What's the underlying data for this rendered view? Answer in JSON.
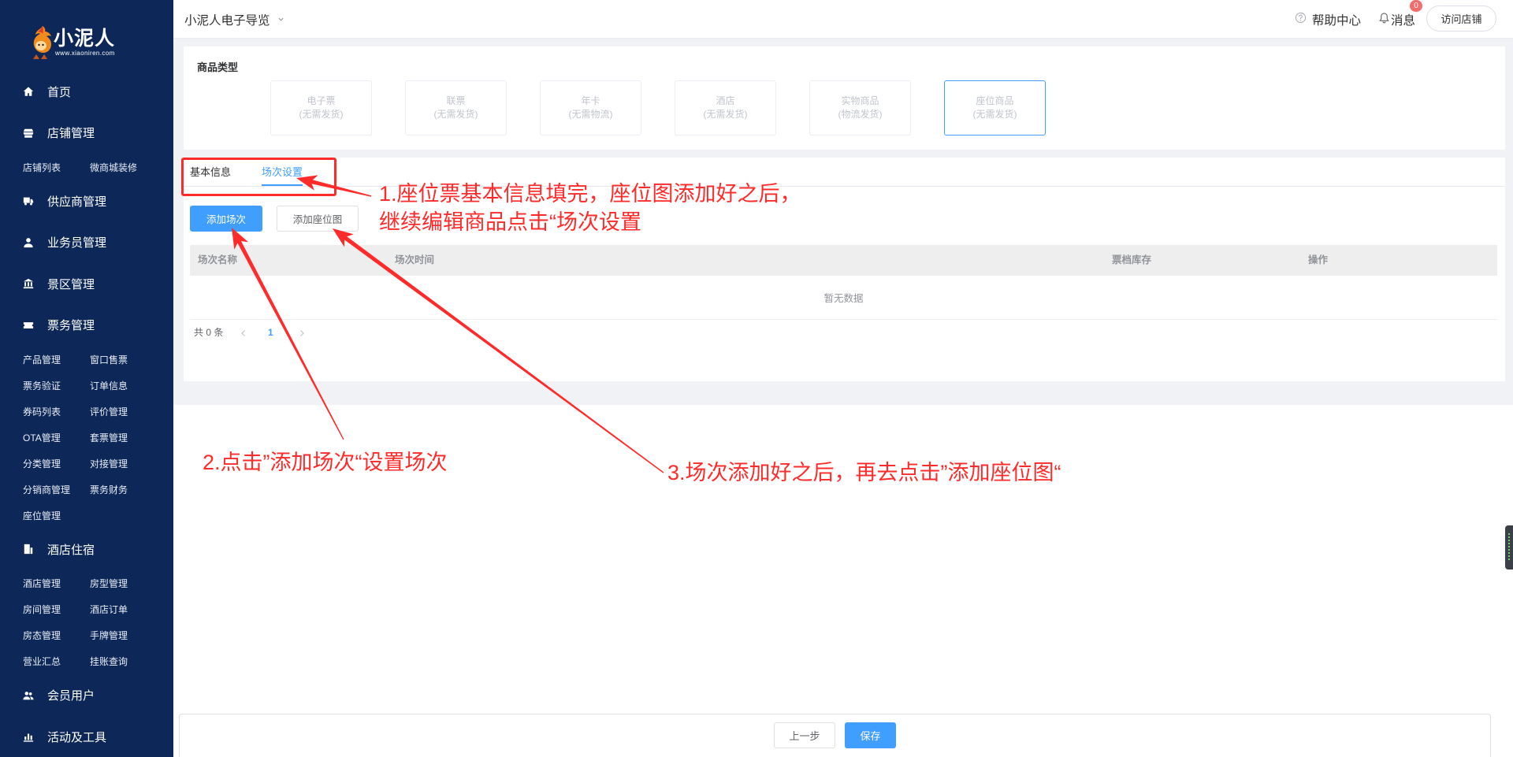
{
  "colors": {
    "primary": "#409eff",
    "sidebar_bg": "#0d2858",
    "annotation": "#ff2b2b",
    "badge": "#f56c6c"
  },
  "brand": {
    "name": "小泥人",
    "url": "www.xiaoniren.com"
  },
  "sidebar": {
    "menu": [
      {
        "label": "首页",
        "icon": "home-icon"
      },
      {
        "label": "店铺管理",
        "icon": "store-icon",
        "children": [
          "店铺列表",
          "微商城装修"
        ]
      },
      {
        "label": "供应商管理",
        "icon": "truck-icon"
      },
      {
        "label": "业务员管理",
        "icon": "user-icon"
      },
      {
        "label": "景区管理",
        "icon": "landmark-icon"
      },
      {
        "label": "票务管理",
        "icon": "ticket-icon",
        "children": [
          "产品管理",
          "窗口售票",
          "票务验证",
          "订单信息",
          "券码列表",
          "评价管理",
          "OTA管理",
          "套票管理",
          "分类管理",
          "对接管理",
          "分销商管理",
          "票务财务",
          "座位管理"
        ]
      },
      {
        "label": "酒店住宿",
        "icon": "hotel-icon",
        "children": [
          "酒店管理",
          "房型管理",
          "房间管理",
          "酒店订单",
          "房态管理",
          "手牌管理",
          "营业汇总",
          "挂账查询"
        ]
      },
      {
        "label": "会员用户",
        "icon": "users-icon"
      },
      {
        "label": "活动及工具",
        "icon": "chart-icon"
      }
    ]
  },
  "header": {
    "title": "小泥人电子导览",
    "help_label": "帮助中心",
    "message_label": "消息",
    "message_count": "0",
    "visit_store_label": "访问店铺"
  },
  "product_type": {
    "label": "商品类型",
    "options": [
      {
        "name": "电子票",
        "note": "(无需发货)",
        "selected": false
      },
      {
        "name": "联票",
        "note": "(无需发货)",
        "selected": false
      },
      {
        "name": "年卡",
        "note": "(无需物流)",
        "selected": false
      },
      {
        "name": "酒店",
        "note": "(无需发货)",
        "selected": false
      },
      {
        "name": "实物商品",
        "note": "(物流发货)",
        "selected": false
      },
      {
        "name": "座位商品",
        "note": "(无需发货)",
        "selected": true
      }
    ]
  },
  "tabs": [
    {
      "label": "基本信息",
      "active": false
    },
    {
      "label": "场次设置",
      "active": true
    }
  ],
  "toolbar": {
    "add_session_label": "添加场次",
    "add_seatmap_label": "添加座位图"
  },
  "table": {
    "columns": [
      "场次名称",
      "场次时间",
      "票档库存",
      "操作"
    ],
    "empty_text": "暂无数据"
  },
  "pagination": {
    "total_text": "共 0 条",
    "current_page": "1"
  },
  "footer": {
    "prev_label": "上一步",
    "save_label": "保存"
  },
  "annotations": {
    "step1_line1": "1.座位票基本信息填完，座位图添加好之后，",
    "step1_line2": "继续编辑商品点击“场次设置",
    "step2": "2.点击”添加场次“设置场次",
    "step3": "3.场次添加好之后，再去点击”添加座位图“"
  }
}
